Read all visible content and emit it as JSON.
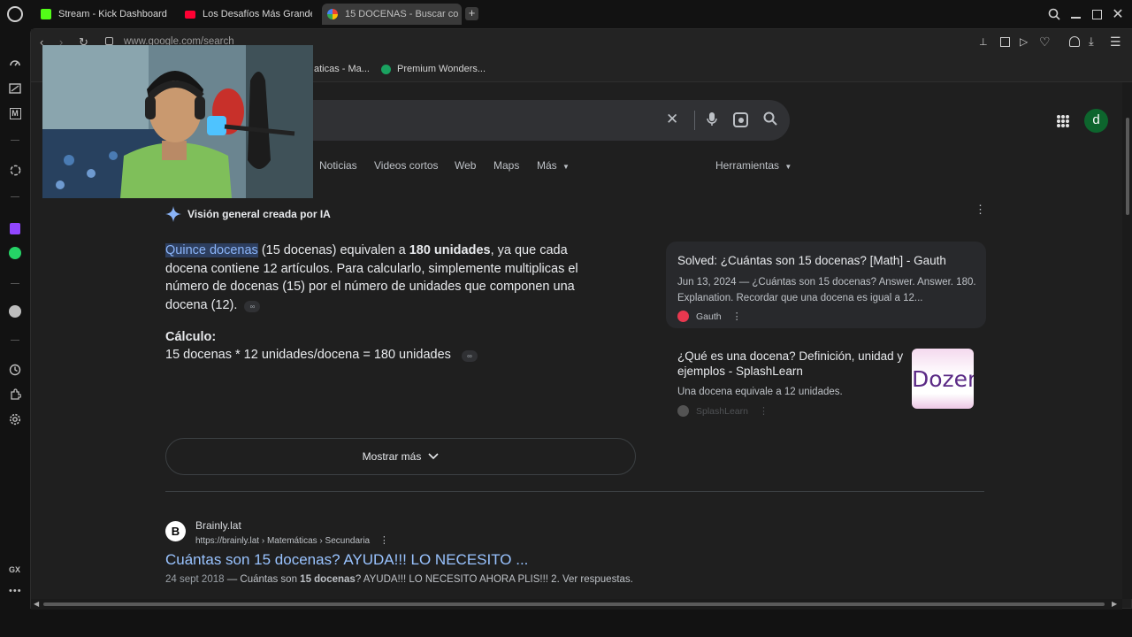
{
  "browser": {
    "tabs": [
      {
        "title": "Stream - Kick Dashboard",
        "icon": "kick-icon",
        "color": "#53fc18"
      },
      {
        "title": "Los Desafíos Más Grande",
        "icon": "youtube-icon",
        "color": "#ff0033"
      },
      {
        "title": "15 DOCENAS - Buscar co",
        "icon": "google-icon",
        "color": "#4285f4"
      }
    ],
    "url": "www.google.com/search",
    "bookmarks": [
      {
        "label": "aticas - Ma..."
      },
      {
        "label": "Premium Wonders..."
      }
    ],
    "sidebar_label": "GX"
  },
  "google": {
    "avatar_letter": "d",
    "nav": [
      {
        "label": "Noticias"
      },
      {
        "label": "Videos cortos"
      },
      {
        "label": "Web"
      },
      {
        "label": "Maps"
      },
      {
        "label": "Más"
      }
    ],
    "tools_label": "Herramientas",
    "ai_overview": {
      "header": "Visión general creada por IA",
      "highlight": "Quince docenas",
      "p1_a": " (15 docenas) equivalen a ",
      "p1_bold": "180 unidades",
      "p1_b": ", ya que cada docena contiene 12 artículos. Para calcularlo, simplemente multiplicas el número de docenas (15) por el número de unidades que componen una docena (12).",
      "calc_title": "Cálculo:",
      "calc_line": "15 docenas * 12 unidades/docena = 180 unidades",
      "more_button": "Mostrar más"
    },
    "sources": [
      {
        "title": "Solved: ¿Cuántas son 15 docenas? [Math] - Gauth",
        "snippet": "Jun 13, 2024 — ¿Cuántas son 15 docenas? Answer. Answer. 180. Explanation. Recordar que una docena es igual a 12...",
        "site": "Gauth"
      },
      {
        "title": "¿Qué es una docena? Definición, unidad y ejemplos - SplashLearn",
        "snippet": "Una docena equivale a 12 unidades.",
        "site": "SplashLearn",
        "thumb_text": "Dozen"
      }
    ],
    "result": {
      "site_name": "Brainly.lat",
      "breadcrumb": "https://brainly.lat › Matemáticas › Secundaria",
      "title": "Cuántas son 15 docenas? AYUDA!!! LO NECESITO ...",
      "date": "24 sept 2018",
      "snippet_a": " — Cuántas son ",
      "snippet_bold": "15 docenas",
      "snippet_b": "? AYUDA!!! LO NECESITO AHORA PLIS!!! 2. Ver respuestas."
    }
  }
}
